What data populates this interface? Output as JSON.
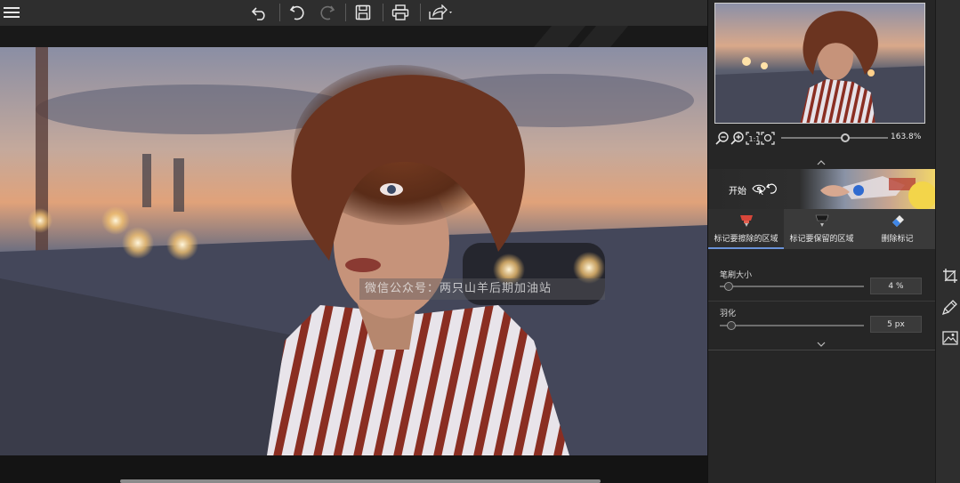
{
  "toolbar": {
    "menu_icon": "hamburger-menu-icon",
    "back_icon": "back-arrow-icon",
    "undo_icon": "undo-icon",
    "redo_icon": "redo-icon",
    "save_icon": "save-icon",
    "print_icon": "print-icon",
    "share_icon": "share-icon"
  },
  "canvas": {
    "watermark": "微信公众号：两只山羊后期加油站"
  },
  "navigator": {
    "zoom_value": "163.8%",
    "zoom_level": 0.6
  },
  "panel": {
    "start_label": "开始",
    "tabs": [
      {
        "label": "标记要擦除的区域",
        "icon": "red-marker-icon",
        "active": true
      },
      {
        "label": "标记要保留的区域",
        "icon": "black-marker-icon",
        "active": false
      },
      {
        "label": "删除标记",
        "icon": "eraser-icon",
        "active": false
      }
    ],
    "brush_size": {
      "label": "笔刷大小",
      "value": "4 %",
      "level": 0.04
    },
    "feather": {
      "label": "羽化",
      "value": "5 px",
      "level": 0.08
    }
  },
  "colors": {
    "accent": "#6a92d8",
    "panel_bg": "#262626",
    "toolbar_bg": "#2e2e2e"
  }
}
